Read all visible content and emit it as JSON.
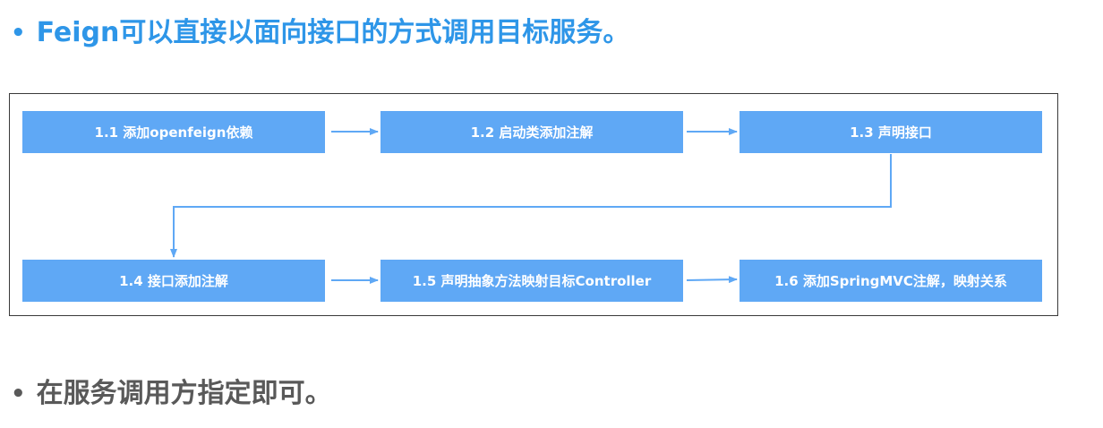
{
  "bullets": [
    {
      "symbol": "•",
      "text": "Feign可以直接以面向接口的方式调用目标服务。",
      "color": "#2e96e8"
    },
    {
      "symbol": "•",
      "text": "在服务调用方指定即可。",
      "color": "#595959"
    }
  ],
  "flow": {
    "box_color": "#5fa8f5",
    "arrow_color": "#5fa8f5",
    "steps": [
      "1.1 添加openfeign依赖",
      "1.2 启动类添加注解",
      "1.3 声明接口",
      "1.4 接口添加注解",
      "1.5 声明抽象方法映射目标Controller",
      "1.6 添加SpringMVC注解，映射关系"
    ]
  }
}
